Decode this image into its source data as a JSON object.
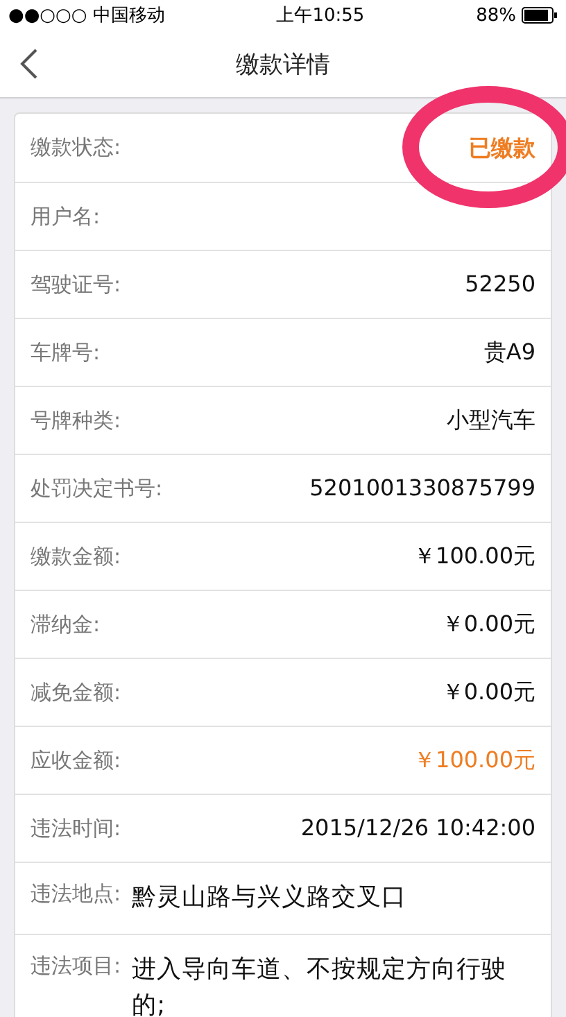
{
  "status_bar": {
    "carrier": "●●○○○ 中国移动",
    "time": "上午10:55",
    "battery": "88%"
  },
  "nav": {
    "title": "缴款详情"
  },
  "rows": [
    {
      "label": "缴款状态:",
      "value": "已缴款",
      "kind": "right",
      "highlight": true
    },
    {
      "label": "用户名:",
      "kind": "right"
    },
    {
      "label": "驾驶证号:",
      "value": "52250",
      "kind": "right",
      "highlight": false
    },
    {
      "label": "车牌号:",
      "value": "贵A9",
      "kind": "right",
      "highlight": false
    },
    {
      "label": "号牌种类:",
      "value": "小型汽车",
      "kind": "right",
      "highlight": false
    },
    {
      "label": "处罚决定书号:",
      "value": "5201001330875799",
      "kind": "right",
      "highlight": false
    },
    {
      "label": "缴款金额:",
      "value": "￥100.00元",
      "kind": "right",
      "highlight": false
    },
    {
      "label": "滞纳金:",
      "value": "￥0.00元",
      "kind": "right",
      "highlight": false
    },
    {
      "label": "减免金额:",
      "value": "￥0.00元",
      "kind": "right",
      "highlight": false
    },
    {
      "label": "应收金额:",
      "value": "￥100.00元",
      "kind": "right",
      "highlight": true
    },
    {
      "label": "违法时间:",
      "value": "2015/12/26 10:42:00",
      "kind": "right",
      "highlight": false
    },
    {
      "label": "违法地点:",
      "value": "黔灵山路与兴义路交叉口",
      "kind": "inline",
      "highlight": false
    },
    {
      "label": "违法项目:",
      "value": "进入导向车道、不按规定方向行驶的;",
      "kind": "inline",
      "highlight": false
    }
  ]
}
